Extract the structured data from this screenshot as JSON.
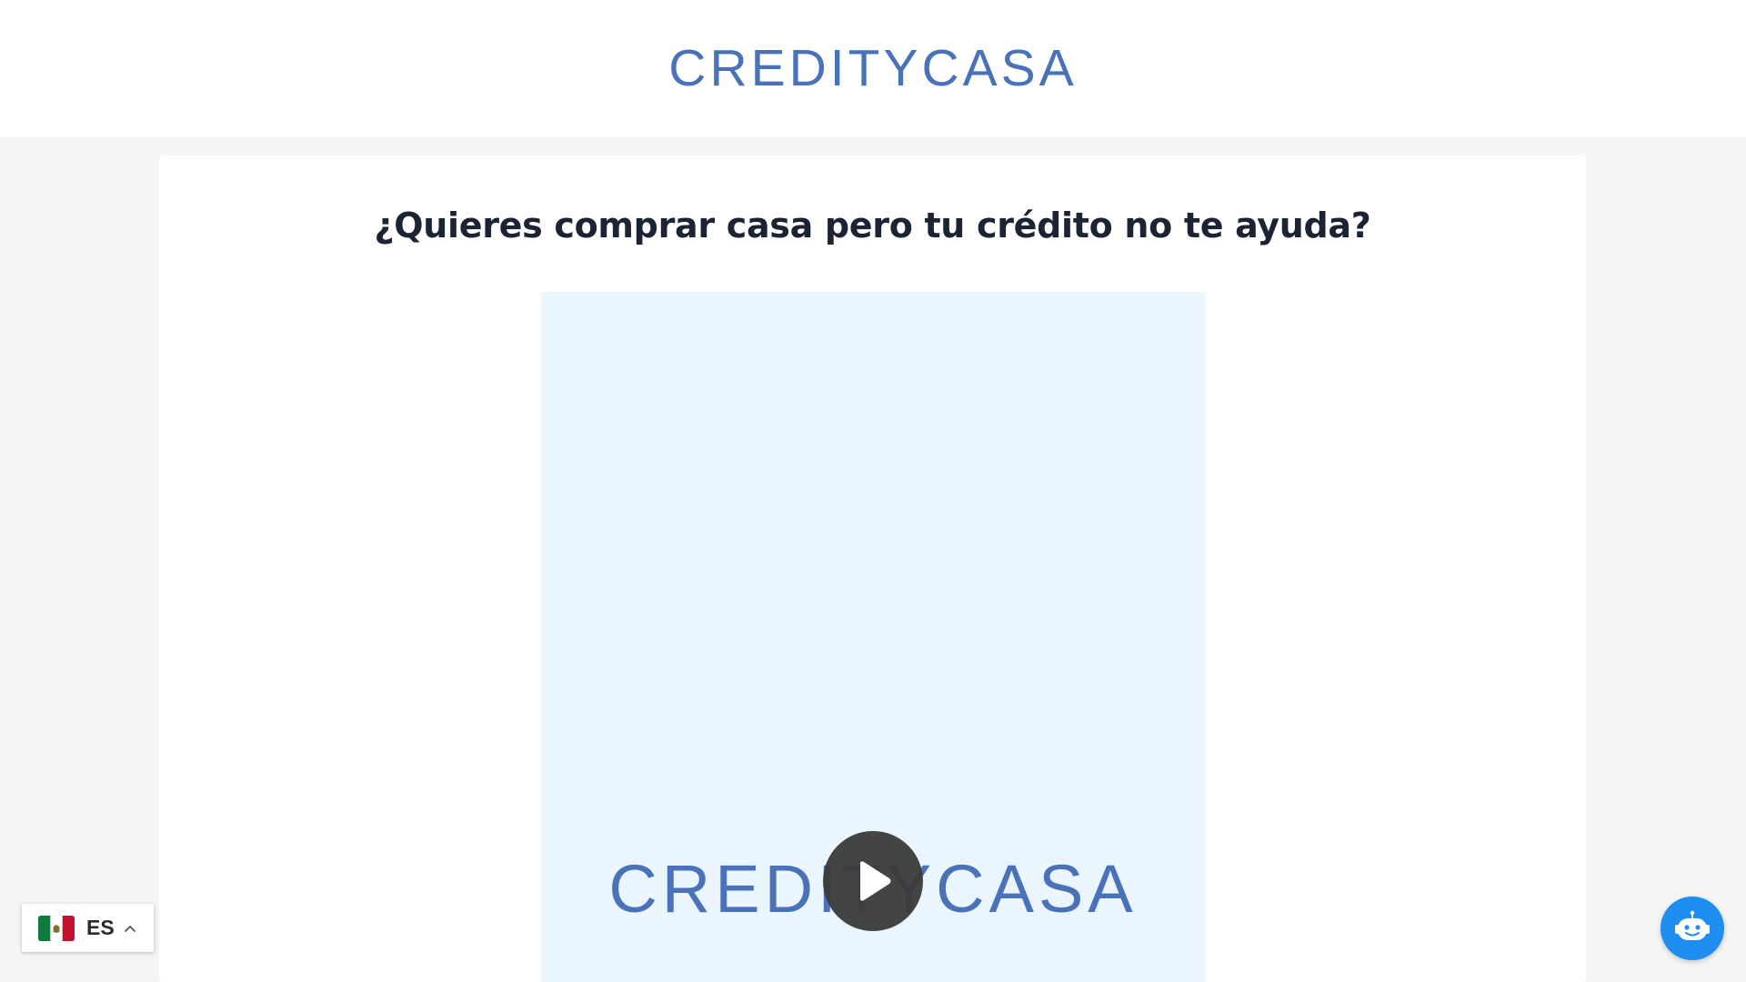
{
  "header": {
    "logo_text": "CREDITYCASA"
  },
  "main": {
    "headline": "¿Quieres comprar casa pero tu crédito no te ayuda?",
    "video": {
      "poster_logo_text": "CREDITYCASA",
      "play_icon": "play-icon"
    }
  },
  "language_switcher": {
    "code": "ES",
    "flag_icon": "mexico-flag-icon",
    "caret_icon": "chevron-up-icon"
  },
  "chat_widget": {
    "icon": "chatbot-icon"
  },
  "colors": {
    "brand_blue": "#4a72b8",
    "video_background": "#eaf5fe",
    "headline_text": "#1c2333",
    "chat_button": "#1e8ef0",
    "page_background": "#f5f5f5"
  }
}
